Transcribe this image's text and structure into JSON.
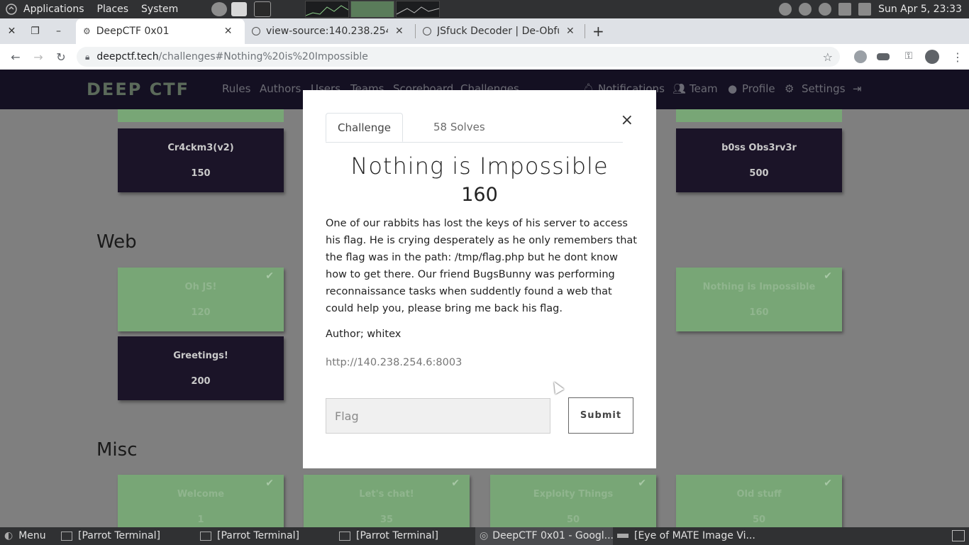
{
  "os_panel": {
    "menus": [
      "Applications",
      "Places",
      "System"
    ],
    "clock": "Sun Apr  5, 23:33"
  },
  "browser": {
    "tabs": [
      {
        "title": "DeepCTF 0x01",
        "active": true
      },
      {
        "title": "view-source:140.238.254.",
        "active": false
      },
      {
        "title": "JSfuck Decoder | De-Obfu",
        "active": false
      }
    ],
    "url_host": "deepctf.tech",
    "url_path": "/challenges#Nothing%20is%20Impossible"
  },
  "site": {
    "logo": "DEEP CTF",
    "nav": [
      "Rules",
      "Authors",
      "Users",
      "Teams",
      "Scoreboard",
      "Challenges"
    ],
    "nav_right": [
      "Notifications",
      "Team",
      "Profile",
      "Settings"
    ]
  },
  "sections": {
    "web": "Web",
    "misc": "Misc"
  },
  "cards": {
    "crackme": {
      "name": "Cr4ckm3(v2)",
      "value": "150"
    },
    "boss": {
      "name": "b0ss Obs3rv3r",
      "value": "500"
    },
    "ohjs": {
      "name": "Oh JS!",
      "value": "120"
    },
    "nothing": {
      "name": "Nothing is Impossible",
      "value": "160"
    },
    "greetings": {
      "name": "Greetings!",
      "value": "200"
    },
    "welcome": {
      "name": "Welcome",
      "value": "1"
    },
    "letschat": {
      "name": "Let's chat!",
      "value": "35"
    },
    "exploity": {
      "name": "Exploity Things",
      "value": "50"
    },
    "oldstuff": {
      "name": "Old stuff",
      "value": "50"
    }
  },
  "modal": {
    "tab_challenge": "Challenge",
    "tab_solves": "58 Solves",
    "close": "×",
    "title": "Nothing is Impossible",
    "points": "160",
    "description": "One of our rabbits has lost the keys of his server to access his flag. He is crying desperately as he only remembers that the flag was in the path: /tmp/flag.php but he dont know how to get there. Our friend BugsBunny was performing reconnaissance tasks when suddently found a web that could help you, please bring me back his flag.",
    "author": "Author; whitex",
    "link": "http://140.238.254.6:8003",
    "flag_placeholder": "Flag",
    "submit": "Submit"
  },
  "taskbar": {
    "menu": "Menu",
    "tasks": [
      {
        "label": "[Parrot Terminal]"
      },
      {
        "label": "[Parrot Terminal]"
      },
      {
        "label": "[Parrot Terminal]"
      },
      {
        "label": "DeepCTF 0x01 - Googl..."
      },
      {
        "label": "[Eye of MATE Image Vi..."
      }
    ]
  }
}
